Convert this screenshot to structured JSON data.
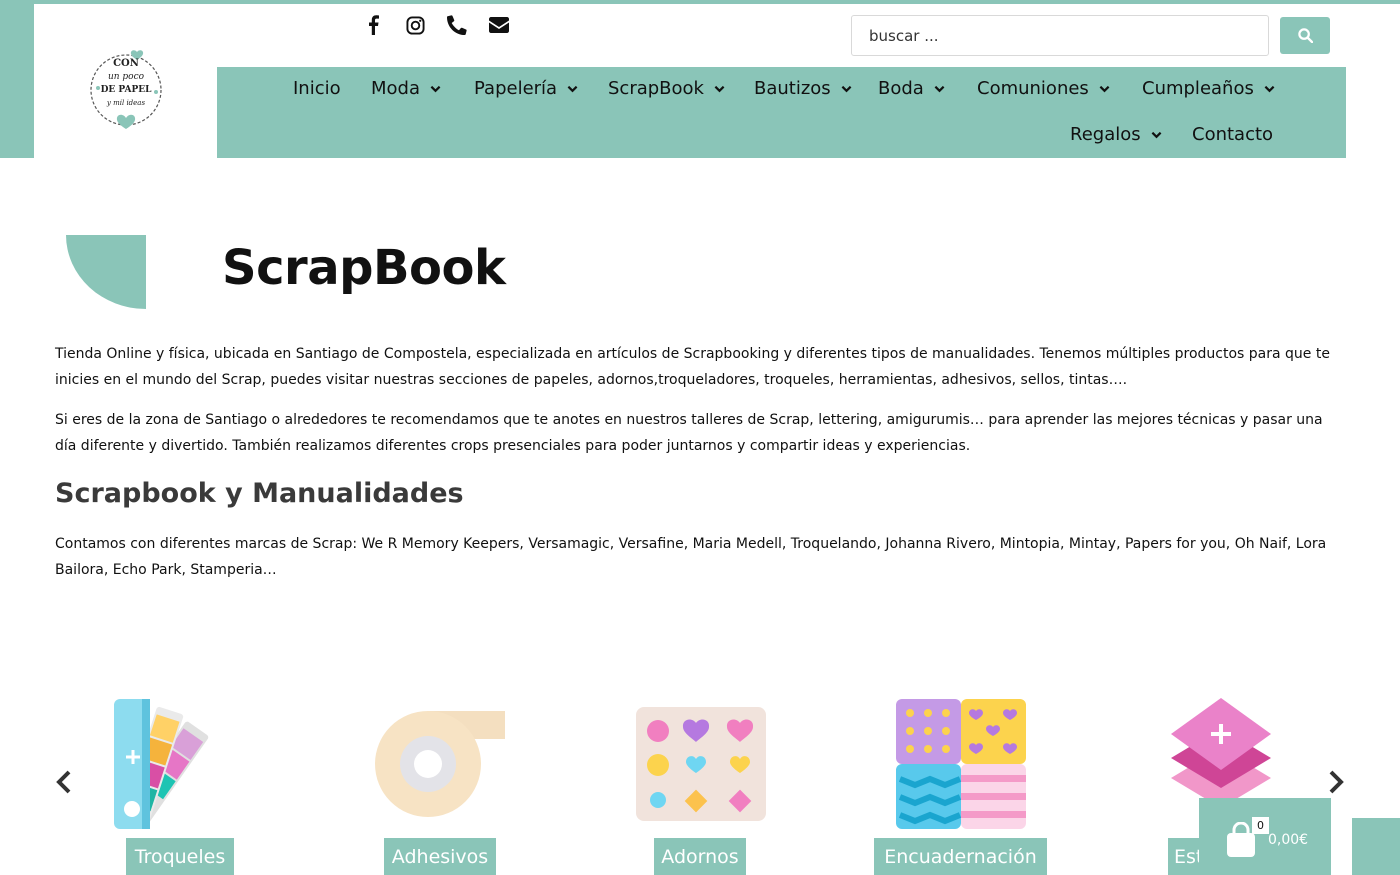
{
  "header": {
    "logo_text": [
      "CON",
      "un poco",
      "DE PAPEL",
      "y mil ideas"
    ],
    "social_icons": [
      "facebook-icon",
      "instagram-icon",
      "phone-icon",
      "envelope-icon"
    ],
    "search": {
      "placeholder": "buscar ...",
      "button_icon": "search-icon"
    }
  },
  "nav": {
    "items": [
      {
        "label": "Inicio",
        "has_dropdown": false
      },
      {
        "label": "Moda",
        "has_dropdown": true
      },
      {
        "label": "Papelería",
        "has_dropdown": true
      },
      {
        "label": "ScrapBook",
        "has_dropdown": true
      },
      {
        "label": "Bautizos",
        "has_dropdown": true
      },
      {
        "label": "Boda",
        "has_dropdown": true
      },
      {
        "label": "Comuniones",
        "has_dropdown": true
      },
      {
        "label": "Cumpleaños",
        "has_dropdown": true
      },
      {
        "label": "Regalos",
        "has_dropdown": true
      },
      {
        "label": "Contacto",
        "has_dropdown": false
      }
    ]
  },
  "main": {
    "title": "ScrapBook",
    "paragraphs": [
      "Tienda Online y física, ubicada en Santiago de Compostela, especializada en artículos de Scrapbooking y diferentes tipos de manualidades. Tenemos múltiples productos para que te inicies en el mundo del Scrap, puedes visitar nuestras secciones de papeles, adornos,troqueladores, troqueles, herramientas, adhesivos, sellos, tintas….",
      "Si eres de la zona de Santiago o alrededores te recomendamos que te anotes en nuestros talleres de Scrap, lettering, amigurumis… para aprender las mejores técnicas y pasar una día diferente y divertido. También realizamos diferentes crops presenciales para poder juntarnos y compartir ideas y experiencias."
    ],
    "subtitle": "Scrapbook y Manualidades",
    "brands_paragraph": "Contamos con diferentes marcas de Scrap: We R Memory Keepers, Versamagic, Versafine, Maria Medell, Troquelando, Johanna Rivero, Mintopia, Mintay, Papers for you, Oh Naif, Lora Bailora, Echo Park, Stamperia…"
  },
  "carousel": {
    "categories": [
      {
        "label": "Troqueles",
        "icon": "color-swatch-icon"
      },
      {
        "label": "Adhesivos",
        "icon": "tape-roll-icon"
      },
      {
        "label": "Adornos",
        "icon": "stickers-icon"
      },
      {
        "label": "Encuadernación",
        "icon": "paper-patterns-icon"
      },
      {
        "label": "Est",
        "icon": "layers-icon"
      }
    ]
  },
  "cart": {
    "count": "0",
    "total": "0,00€"
  },
  "colors": {
    "accent": "#8ac5b8",
    "text": "#111111",
    "subtitle": "#3a3a3a"
  }
}
